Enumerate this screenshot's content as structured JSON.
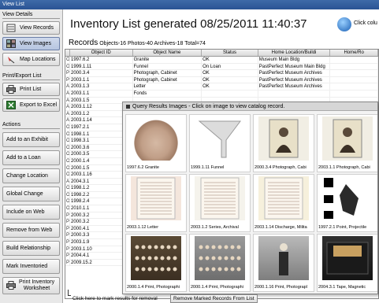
{
  "window": {
    "title": "View List"
  },
  "left": {
    "view_details_label": "View Details",
    "view_buttons": [
      {
        "label": "View Records",
        "icon": "records-icon"
      },
      {
        "label": "View Images",
        "icon": "images-icon"
      },
      {
        "label": "Map Locations",
        "icon": "map-pin-icon"
      }
    ],
    "print_label": "Print/Export List",
    "print_buttons": [
      {
        "label": "Print List",
        "icon": "printer-icon"
      },
      {
        "label": "Export to Excel",
        "icon": "excel-icon"
      }
    ],
    "actions_label": "Actions",
    "actions": [
      "Add to an Exhibit",
      "Add to a Loan",
      "Change Location",
      "Global Change",
      "Include on Web",
      "Remove from Web",
      "Build Relationship",
      "Mark Inventoried"
    ],
    "print_worksheet_line1": "Print Inventory",
    "print_worksheet_line2": "Worksheet"
  },
  "main": {
    "title": "Inventory List generated 08/25/2011 11:40:37",
    "click_hint": "Click colu",
    "records_label": "Records",
    "records_counts": "Objects-16 Photos-40 Archives-18  Total=74",
    "columns": [
      "Object ID",
      "Object Name",
      "Status",
      "Home Location/Buildi",
      "Home/Ro"
    ],
    "rows": [
      {
        "ch": "O",
        "id": "1997.6.2",
        "name": "Granite",
        "status": "OK",
        "loc": "Museum Main Bldg"
      },
      {
        "ch": "O",
        "id": "1999.1.11",
        "name": "Funnel",
        "status": "On Loan",
        "loc": "PastPerfect Museum Main Bldg"
      },
      {
        "ch": "P",
        "id": "2000.3.4",
        "name": "Photograph, Cabinet",
        "status": "OK",
        "loc": "PastPerfect Museum Archives"
      },
      {
        "ch": "P",
        "id": "2003.1.1",
        "name": "Photograph, Cabinet",
        "status": "OK",
        "loc": "PastPerfect Museum Archives"
      },
      {
        "ch": "A",
        "id": "2003.1.3",
        "name": "Letter",
        "status": "OK",
        "loc": "PastPerfect Museum Archives"
      },
      {
        "ch": "A",
        "id": "2003.1.1",
        "name": "Fonds",
        "status": "",
        "loc": ""
      },
      {
        "ch": "A",
        "id": "2003.1.5",
        "name": "",
        "status": "",
        "loc": ""
      },
      {
        "ch": "A",
        "id": "2003.1.12",
        "name": "",
        "status": "",
        "loc": ""
      },
      {
        "ch": "A",
        "id": "2003.1.2",
        "name": "",
        "status": "",
        "loc": ""
      },
      {
        "ch": "A",
        "id": "2003.1.14",
        "name": "",
        "status": "",
        "loc": ""
      },
      {
        "ch": "O",
        "id": "1997.2.1",
        "name": "",
        "status": "",
        "loc": ""
      },
      {
        "ch": "O",
        "id": "1998.1.1",
        "name": "",
        "status": "",
        "loc": ""
      },
      {
        "ch": "O",
        "id": "1998.3.1",
        "name": "",
        "status": "",
        "loc": ""
      },
      {
        "ch": "O",
        "id": "2000.3.6",
        "name": "",
        "status": "",
        "loc": ""
      },
      {
        "ch": "O",
        "id": "2000.3.5",
        "name": "",
        "status": "",
        "loc": ""
      },
      {
        "ch": "O",
        "id": "2000.1.4",
        "name": "",
        "status": "",
        "loc": ""
      },
      {
        "ch": "O",
        "id": "2000.1.5",
        "name": "",
        "status": "",
        "loc": ""
      },
      {
        "ch": "O",
        "id": "2003.1.16",
        "name": "",
        "status": "",
        "loc": ""
      },
      {
        "ch": "A",
        "id": "2004.3.1",
        "name": "",
        "status": "",
        "loc": ""
      },
      {
        "ch": "O",
        "id": "1998.1.2",
        "name": "",
        "status": "",
        "loc": ""
      },
      {
        "ch": "O",
        "id": "1998.2.2",
        "name": "",
        "status": "",
        "loc": ""
      },
      {
        "ch": "O",
        "id": "1998.2.4",
        "name": "",
        "status": "",
        "loc": ""
      },
      {
        "ch": "O",
        "id": "2010.1.1",
        "name": "",
        "status": "",
        "loc": ""
      },
      {
        "ch": "P",
        "id": "2000.3.2",
        "name": "",
        "status": "",
        "loc": ""
      },
      {
        "ch": "P",
        "id": "2000.3.2",
        "name": "",
        "status": "",
        "loc": ""
      },
      {
        "ch": "P",
        "id": "2000.4.1",
        "name": "",
        "status": "",
        "loc": ""
      },
      {
        "ch": "P",
        "id": "2000.3.3",
        "name": "",
        "status": "",
        "loc": ""
      },
      {
        "ch": "P",
        "id": "2003.1.9",
        "name": "",
        "status": "",
        "loc": ""
      },
      {
        "ch": "P",
        "id": "2003.1.10",
        "name": "",
        "status": "",
        "loc": ""
      },
      {
        "ch": "P",
        "id": "2004.4.1",
        "name": "",
        "status": "",
        "loc": ""
      },
      {
        "ch": "P",
        "id": "2009.15.2",
        "name": "",
        "status": "",
        "loc": ""
      }
    ]
  },
  "popup": {
    "title": "Query Results Images - Click on image to view catalog record.",
    "thumbs": [
      {
        "caption": "1997.6.2 Granite",
        "kind": "granite"
      },
      {
        "caption": "1999.1.11 Funnel",
        "kind": "funnel"
      },
      {
        "caption": "2000.3.4 Photograph, Cabi",
        "kind": "portrait"
      },
      {
        "caption": "2003.1.1 Photograph, Cabi",
        "kind": "portrait"
      },
      {
        "caption": "2003.1.12 Letter",
        "kind": "letter"
      },
      {
        "caption": "2003.1.2 Series, Archival",
        "kind": "archival"
      },
      {
        "caption": "2003.1.14 Discharge, Milita",
        "kind": "discharge"
      },
      {
        "caption": "1997.2.1 Point, Projectile",
        "kind": "point"
      },
      {
        "caption": "2000.1.4 Print, Photographi",
        "kind": "groupphoto"
      },
      {
        "caption": "2000.1.4 Print, Photographi",
        "kind": "groupphoto2"
      },
      {
        "caption": "2000.1.16 Print, Photograpl",
        "kind": "soldier"
      },
      {
        "caption": "2004.3.1 Tape, Magnetic",
        "kind": "tape"
      }
    ]
  },
  "bottom": {
    "hint": "Click here to mark results for removal",
    "remove_label": "Remove Marked Records From List"
  }
}
